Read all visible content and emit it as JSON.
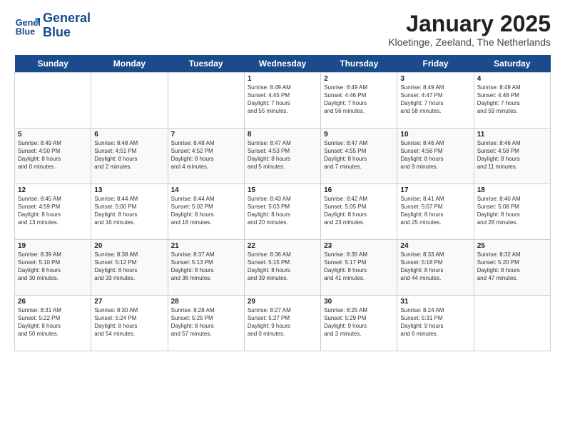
{
  "header": {
    "logo_line1": "General",
    "logo_line2": "Blue",
    "title": "January 2025",
    "subtitle": "Kloetinge, Zeeland, The Netherlands"
  },
  "days_of_week": [
    "Sunday",
    "Monday",
    "Tuesday",
    "Wednesday",
    "Thursday",
    "Friday",
    "Saturday"
  ],
  "weeks": [
    [
      {
        "num": "",
        "text": ""
      },
      {
        "num": "",
        "text": ""
      },
      {
        "num": "",
        "text": ""
      },
      {
        "num": "1",
        "text": "Sunrise: 8:49 AM\nSunset: 4:45 PM\nDaylight: 7 hours\nand 55 minutes."
      },
      {
        "num": "2",
        "text": "Sunrise: 8:49 AM\nSunset: 4:46 PM\nDaylight: 7 hours\nand 56 minutes."
      },
      {
        "num": "3",
        "text": "Sunrise: 8:49 AM\nSunset: 4:47 PM\nDaylight: 7 hours\nand 58 minutes."
      },
      {
        "num": "4",
        "text": "Sunrise: 8:49 AM\nSunset: 4:48 PM\nDaylight: 7 hours\nand 59 minutes."
      }
    ],
    [
      {
        "num": "5",
        "text": "Sunrise: 8:49 AM\nSunset: 4:50 PM\nDaylight: 8 hours\nand 0 minutes."
      },
      {
        "num": "6",
        "text": "Sunrise: 8:48 AM\nSunset: 4:51 PM\nDaylight: 8 hours\nand 2 minutes."
      },
      {
        "num": "7",
        "text": "Sunrise: 8:48 AM\nSunset: 4:52 PM\nDaylight: 8 hours\nand 4 minutes."
      },
      {
        "num": "8",
        "text": "Sunrise: 8:47 AM\nSunset: 4:53 PM\nDaylight: 8 hours\nand 5 minutes."
      },
      {
        "num": "9",
        "text": "Sunrise: 8:47 AM\nSunset: 4:55 PM\nDaylight: 8 hours\nand 7 minutes."
      },
      {
        "num": "10",
        "text": "Sunrise: 8:46 AM\nSunset: 4:56 PM\nDaylight: 8 hours\nand 9 minutes."
      },
      {
        "num": "11",
        "text": "Sunrise: 8:46 AM\nSunset: 4:58 PM\nDaylight: 8 hours\nand 11 minutes."
      }
    ],
    [
      {
        "num": "12",
        "text": "Sunrise: 8:45 AM\nSunset: 4:59 PM\nDaylight: 8 hours\nand 13 minutes."
      },
      {
        "num": "13",
        "text": "Sunrise: 8:44 AM\nSunset: 5:00 PM\nDaylight: 8 hours\nand 16 minutes."
      },
      {
        "num": "14",
        "text": "Sunrise: 8:44 AM\nSunset: 5:02 PM\nDaylight: 8 hours\nand 18 minutes."
      },
      {
        "num": "15",
        "text": "Sunrise: 8:43 AM\nSunset: 5:03 PM\nDaylight: 8 hours\nand 20 minutes."
      },
      {
        "num": "16",
        "text": "Sunrise: 8:42 AM\nSunset: 5:05 PM\nDaylight: 8 hours\nand 23 minutes."
      },
      {
        "num": "17",
        "text": "Sunrise: 8:41 AM\nSunset: 5:07 PM\nDaylight: 8 hours\nand 25 minutes."
      },
      {
        "num": "18",
        "text": "Sunrise: 8:40 AM\nSunset: 5:08 PM\nDaylight: 8 hours\nand 28 minutes."
      }
    ],
    [
      {
        "num": "19",
        "text": "Sunrise: 8:39 AM\nSunset: 5:10 PM\nDaylight: 8 hours\nand 30 minutes."
      },
      {
        "num": "20",
        "text": "Sunrise: 8:38 AM\nSunset: 5:12 PM\nDaylight: 8 hours\nand 33 minutes."
      },
      {
        "num": "21",
        "text": "Sunrise: 8:37 AM\nSunset: 5:13 PM\nDaylight: 8 hours\nand 36 minutes."
      },
      {
        "num": "22",
        "text": "Sunrise: 8:36 AM\nSunset: 5:15 PM\nDaylight: 8 hours\nand 39 minutes."
      },
      {
        "num": "23",
        "text": "Sunrise: 8:35 AM\nSunset: 5:17 PM\nDaylight: 8 hours\nand 41 minutes."
      },
      {
        "num": "24",
        "text": "Sunrise: 8:33 AM\nSunset: 5:18 PM\nDaylight: 8 hours\nand 44 minutes."
      },
      {
        "num": "25",
        "text": "Sunrise: 8:32 AM\nSunset: 5:20 PM\nDaylight: 8 hours\nand 47 minutes."
      }
    ],
    [
      {
        "num": "26",
        "text": "Sunrise: 8:31 AM\nSunset: 5:22 PM\nDaylight: 8 hours\nand 50 minutes."
      },
      {
        "num": "27",
        "text": "Sunrise: 8:30 AM\nSunset: 5:24 PM\nDaylight: 8 hours\nand 54 minutes."
      },
      {
        "num": "28",
        "text": "Sunrise: 8:28 AM\nSunset: 5:25 PM\nDaylight: 8 hours\nand 57 minutes."
      },
      {
        "num": "29",
        "text": "Sunrise: 8:27 AM\nSunset: 5:27 PM\nDaylight: 9 hours\nand 0 minutes."
      },
      {
        "num": "30",
        "text": "Sunrise: 8:25 AM\nSunset: 5:29 PM\nDaylight: 9 hours\nand 3 minutes."
      },
      {
        "num": "31",
        "text": "Sunrise: 8:24 AM\nSunset: 5:31 PM\nDaylight: 9 hours\nand 6 minutes."
      },
      {
        "num": "",
        "text": ""
      }
    ]
  ]
}
